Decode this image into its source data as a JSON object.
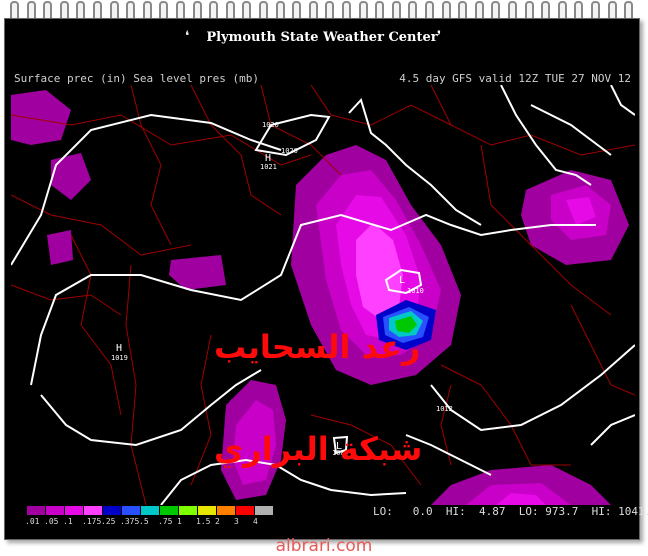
{
  "header": {
    "title": "Plymouth State Weather Center"
  },
  "plot": {
    "title": "Surface prec (in) Sea level pres (mb)",
    "valid": "4.5 day GFS valid 12Z TUE 27 NOV 12"
  },
  "pressure_labels": [
    {
      "type": "H",
      "value": "1020"
    },
    {
      "type": "H",
      "value": "1020"
    },
    {
      "type": "H",
      "value": "1021"
    },
    {
      "type": "H",
      "value": "1019"
    },
    {
      "type": "L",
      "value": "1010"
    },
    {
      "type": "L",
      "value": "1012"
    },
    {
      "type": "L",
      "value": "1007"
    }
  ],
  "legend": {
    "labels": [
      ".01",
      ".05",
      ".1",
      ".175",
      ".25",
      ".375",
      ".5",
      ".75",
      "1",
      "1.5",
      "2",
      "3",
      "4"
    ],
    "colors": [
      "#a000a0",
      "#c800c8",
      "#e60ae6",
      "#ff40ff",
      "#0000c8",
      "#2850ff",
      "#00c8c8",
      "#00c800",
      "#80ff00",
      "#e6e600",
      "#ff8000",
      "#ff0000",
      "#b0b0b0"
    ]
  },
  "stats": {
    "lo_label": "LO:",
    "lo_val": "0.0",
    "hi_label": "HI:",
    "hi_val": "4.87",
    "lo2_label": "LO:",
    "lo2_val": "973.7",
    "hi2_label": "HI:",
    "hi2_val": "1041.5"
  },
  "overlay": {
    "line1": "رعد السحايب",
    "line2": "شبكة البراري"
  },
  "watermark": "albrari.com"
}
